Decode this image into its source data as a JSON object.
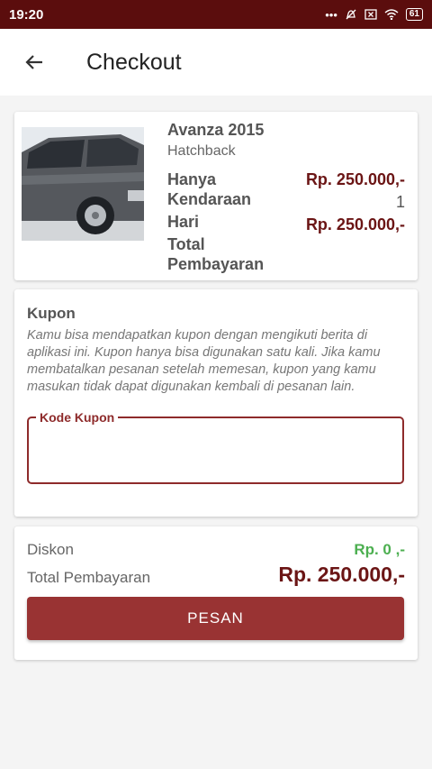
{
  "status": {
    "time": "19:20",
    "battery": "61"
  },
  "header": {
    "title": "Checkout"
  },
  "vehicle": {
    "name": "Avanza 2015",
    "type": "Hatchback",
    "price_label": "Hanya",
    "price_value": "Rp. 250.000,-",
    "vehicle_label": "Kendaraan",
    "vehicle_value": "1",
    "days_label": "Hari",
    "days_value": "Rp. 250.000,-",
    "total_label_1": "Total",
    "total_label_2": "Pembayaran"
  },
  "coupon": {
    "title": "Kupon",
    "description": "Kamu bisa mendapatkan kupon dengan mengikuti berita di aplikasi ini. Kupon hanya bisa digunakan satu kali. Jika kamu membatalkan pesanan setelah memesan, kupon yang kamu masukan tidak dapat digunakan kembali di pesanan lain.",
    "field_label": "Kode Kupon",
    "field_value": ""
  },
  "summary": {
    "discount_label": "Diskon",
    "discount_value": "Rp. 0 ,-",
    "total_label": "Total Pembayaran",
    "total_value": "Rp. 250.000,-",
    "button_label": "PESAN"
  },
  "colors": {
    "status_bar": "#5b0d0d",
    "accent": "#993333",
    "price": "#6b1515",
    "discount": "#4caf50"
  }
}
